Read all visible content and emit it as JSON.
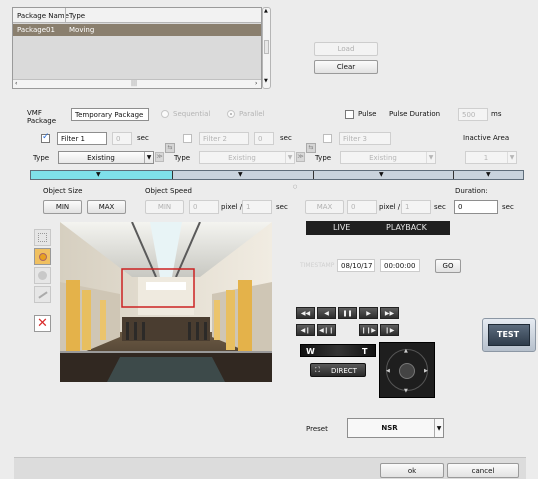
{
  "package_table": {
    "columns": [
      "Package Name",
      "Type"
    ],
    "rows": [
      {
        "name": "Package01",
        "type": "Moving"
      }
    ],
    "hscroll_mark": "|||"
  },
  "package_buttons": {
    "load": "Load",
    "clear": "Clear"
  },
  "vmf": {
    "label": "VMF Package",
    "name_value": "Temporary Package",
    "sequential": "Sequential",
    "parallel": "Parallel",
    "pulse": "Pulse",
    "pulse_duration": "Pulse Duration",
    "pulse_value": "500",
    "pulse_unit": "ms"
  },
  "filters": [
    {
      "name": "Filter 1",
      "sec_value": "0",
      "sec": "sec",
      "type_label": "Type",
      "type_value": "Existing",
      "enabled": true
    },
    {
      "name": "Filter 2",
      "sec_value": "0",
      "sec": "sec",
      "type_label": "Type",
      "type_value": "Existing",
      "enabled": false
    },
    {
      "name": "Filter 3",
      "type_label": "Type",
      "type_value": "Existing",
      "enabled": false
    }
  ],
  "inactive_area": {
    "label": "Inactive Area",
    "value": "1"
  },
  "object_size": {
    "label": "Object Size",
    "min": "MIN",
    "max": "MAX"
  },
  "object_speed": {
    "label": "Object Speed",
    "min": "MIN",
    "min_value": "0",
    "pixel": "pixel /",
    "sec_value": "1",
    "sec": "sec",
    "max": "MAX",
    "max_value": "0",
    "pixel2": "pixel /",
    "sec_value2": "1",
    "sec2": "sec"
  },
  "duration": {
    "label": "Duration:",
    "value": "0",
    "unit": "sec"
  },
  "mode": {
    "live": "LIVE",
    "playback": "PLAYBACK"
  },
  "datetime": {
    "label": "TIMESTAMP",
    "date": "08/10/17",
    "time": "00:00:00",
    "go": "GO"
  },
  "playback_controls": {
    "row1": [
      "◀◀",
      "◀",
      "❚❚",
      "▶",
      "▶▶"
    ],
    "row2": [
      "◀❙",
      "◀❙❙",
      "❙❙▶",
      "❙▶"
    ]
  },
  "ptz": {
    "wide": "W",
    "tele": "T",
    "direct": "DIRECT"
  },
  "test_button": "TEST",
  "preset": {
    "label": "Preset",
    "value": "NSR"
  },
  "footer": {
    "ok": "ok",
    "cancel": "cancel"
  },
  "colors": {
    "selected_row": "#8a7f6e",
    "timeline_active": "#7fe0ea",
    "timeline_inactive": "#c9d3dd",
    "detection_box": "#cc2222",
    "close_icon": "#d92b2b"
  }
}
